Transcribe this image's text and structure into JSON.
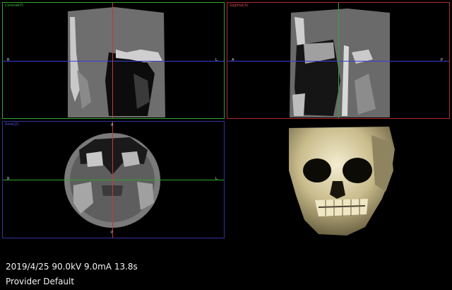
{
  "viewports": {
    "coronal": {
      "title": "Coronal(Y)",
      "left_label": "R",
      "right_label": "L",
      "accent": "#2fa52f"
    },
    "sagittal": {
      "title": "Sagittal(X)",
      "left_label": "A",
      "right_label": "P",
      "accent": "#b52a2a"
    },
    "axial": {
      "title": "Axial(Z)",
      "left_label": "R",
      "right_label": "L",
      "top_label": "A",
      "bottom_label": "P",
      "accent": "#33339a"
    },
    "render3d": {
      "icon": "3d-skull-render"
    }
  },
  "scan_info": {
    "acquisition": "2019/4/25 90.0kV 9.0mA 13.8s",
    "provider": "Provider Default"
  }
}
